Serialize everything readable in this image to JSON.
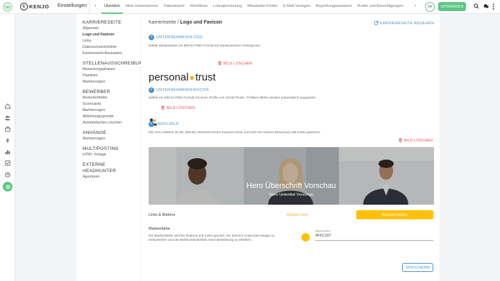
{
  "topbar": {
    "avatar_initials": "OO",
    "logo_text": "KENJO",
    "title": "Einstellungen",
    "tabs": [
      {
        "label": "Überblick",
        "active": true
      },
      {
        "label": "Mein Unternehmen"
      },
      {
        "label": "Datenimport"
      },
      {
        "label": "Workflows"
      },
      {
        "label": "Lohnabrechnung"
      },
      {
        "label": "Mitarbeiter-Felder"
      },
      {
        "label": "E-Mail-Vorlagen"
      },
      {
        "label": "Begrüßungsassistent"
      },
      {
        "label": "Profile und Berechtigungen"
      }
    ],
    "badge_count": "14",
    "upgrade_label": "UPGRADEN"
  },
  "menu": {
    "sections": [
      {
        "title": "KARRIERESEITE",
        "items": [
          "Allgemein",
          "Logo und Favicon",
          "Links",
          "Datenschutzrichtlinie",
          "Karriereseite-Baukasten"
        ]
      },
      {
        "title": "STELLENAUSSCHREIBUNG",
        "items": [
          "Bewerbungsphasen",
          "Pipelines",
          "Markierungen"
        ]
      },
      {
        "title": "BEWERBER",
        "items": [
          "Bewerberfelder",
          "Scorecards",
          "Markierungen",
          "Ablehnungsgründe",
          "Automatisches Löschen"
        ]
      },
      {
        "title": "ANHÄNGE",
        "items": [
          "Markierungen"
        ]
      },
      {
        "title": "MULTIPOSTING",
        "items": [
          "HTML Vorlage"
        ]
      },
      {
        "title": "EXTERNE HEADHUNTER",
        "items": [
          "Agenturen"
        ]
      }
    ]
  },
  "main": {
    "breadcrumb_parent": "Karriereseite / ",
    "breadcrumb_current": "Logo und Favicon",
    "view_link": "KARRIERESEITE ANSEHEN",
    "logo": {
      "heading": "UNTERNEHMENSLOGO",
      "desc": "Wähle idealerweise ein Bild im PNG-Format mit transparentem Hintergrund.",
      "preview_left": "personal",
      "preview_right": "trust",
      "delete": "BILD LÖSCHEN"
    },
    "favicon": {
      "heading": "UNTERNEHMENSFAVICON",
      "desc": "Wähle ein Bild im PNG-Format mit einer Größe von 32x32 Pixeln. Größere Bilder werden automatisch angepasst.",
      "delete": "BILD LÖSCHEN"
    },
    "hero": {
      "heading": "HERO-BILD",
      "desc": "Die Hero-Sektion ist der oberste Abschnitt Deiner Karriere-Seite und wird von Deinen Besuchern als erstes gesehen.",
      "delete": "BILD LÖSCHEN",
      "title": "Hero Überschrift Vorschau",
      "subtitle": "Hero Untertitel Vorschau"
    },
    "links_buttons": {
      "label": "Links & Buttons",
      "sample_link": "Beispiel-Link",
      "sample_button": "Beispiel-Button"
    },
    "brand_color": {
      "label": "Markenfarbe",
      "desc": "Die Markenfarbe wird für Buttons und Links genutzt, um Deinem Corporate Design zu entsprechen und die Wahrscheinlichkeit einer Bewerbung zu erhöhen.",
      "field_label": "Markenfarbe *",
      "value": "#FFC107"
    },
    "save_label": "SPEICHERN"
  },
  "colors": {
    "accent_green": "#5cc584",
    "link_blue": "#4a90c8",
    "brand_yellow": "#ffc107",
    "danger_red": "#e04b4b"
  }
}
